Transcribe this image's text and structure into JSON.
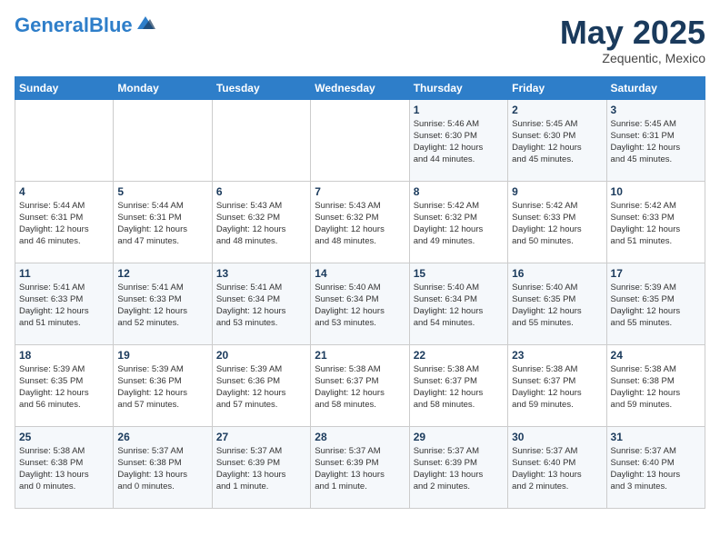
{
  "logo": {
    "general": "General",
    "blue": "Blue",
    "tagline": ""
  },
  "title": "May 2025",
  "subtitle": "Zequentic, Mexico",
  "days_of_week": [
    "Sunday",
    "Monday",
    "Tuesday",
    "Wednesday",
    "Thursday",
    "Friday",
    "Saturday"
  ],
  "weeks": [
    [
      {
        "day": "",
        "info": ""
      },
      {
        "day": "",
        "info": ""
      },
      {
        "day": "",
        "info": ""
      },
      {
        "day": "",
        "info": ""
      },
      {
        "day": "1",
        "info": "Sunrise: 5:46 AM\nSunset: 6:30 PM\nDaylight: 12 hours\nand 44 minutes."
      },
      {
        "day": "2",
        "info": "Sunrise: 5:45 AM\nSunset: 6:30 PM\nDaylight: 12 hours\nand 45 minutes."
      },
      {
        "day": "3",
        "info": "Sunrise: 5:45 AM\nSunset: 6:31 PM\nDaylight: 12 hours\nand 45 minutes."
      }
    ],
    [
      {
        "day": "4",
        "info": "Sunrise: 5:44 AM\nSunset: 6:31 PM\nDaylight: 12 hours\nand 46 minutes."
      },
      {
        "day": "5",
        "info": "Sunrise: 5:44 AM\nSunset: 6:31 PM\nDaylight: 12 hours\nand 47 minutes."
      },
      {
        "day": "6",
        "info": "Sunrise: 5:43 AM\nSunset: 6:32 PM\nDaylight: 12 hours\nand 48 minutes."
      },
      {
        "day": "7",
        "info": "Sunrise: 5:43 AM\nSunset: 6:32 PM\nDaylight: 12 hours\nand 48 minutes."
      },
      {
        "day": "8",
        "info": "Sunrise: 5:42 AM\nSunset: 6:32 PM\nDaylight: 12 hours\nand 49 minutes."
      },
      {
        "day": "9",
        "info": "Sunrise: 5:42 AM\nSunset: 6:33 PM\nDaylight: 12 hours\nand 50 minutes."
      },
      {
        "day": "10",
        "info": "Sunrise: 5:42 AM\nSunset: 6:33 PM\nDaylight: 12 hours\nand 51 minutes."
      }
    ],
    [
      {
        "day": "11",
        "info": "Sunrise: 5:41 AM\nSunset: 6:33 PM\nDaylight: 12 hours\nand 51 minutes."
      },
      {
        "day": "12",
        "info": "Sunrise: 5:41 AM\nSunset: 6:33 PM\nDaylight: 12 hours\nand 52 minutes."
      },
      {
        "day": "13",
        "info": "Sunrise: 5:41 AM\nSunset: 6:34 PM\nDaylight: 12 hours\nand 53 minutes."
      },
      {
        "day": "14",
        "info": "Sunrise: 5:40 AM\nSunset: 6:34 PM\nDaylight: 12 hours\nand 53 minutes."
      },
      {
        "day": "15",
        "info": "Sunrise: 5:40 AM\nSunset: 6:34 PM\nDaylight: 12 hours\nand 54 minutes."
      },
      {
        "day": "16",
        "info": "Sunrise: 5:40 AM\nSunset: 6:35 PM\nDaylight: 12 hours\nand 55 minutes."
      },
      {
        "day": "17",
        "info": "Sunrise: 5:39 AM\nSunset: 6:35 PM\nDaylight: 12 hours\nand 55 minutes."
      }
    ],
    [
      {
        "day": "18",
        "info": "Sunrise: 5:39 AM\nSunset: 6:35 PM\nDaylight: 12 hours\nand 56 minutes."
      },
      {
        "day": "19",
        "info": "Sunrise: 5:39 AM\nSunset: 6:36 PM\nDaylight: 12 hours\nand 57 minutes."
      },
      {
        "day": "20",
        "info": "Sunrise: 5:39 AM\nSunset: 6:36 PM\nDaylight: 12 hours\nand 57 minutes."
      },
      {
        "day": "21",
        "info": "Sunrise: 5:38 AM\nSunset: 6:37 PM\nDaylight: 12 hours\nand 58 minutes."
      },
      {
        "day": "22",
        "info": "Sunrise: 5:38 AM\nSunset: 6:37 PM\nDaylight: 12 hours\nand 58 minutes."
      },
      {
        "day": "23",
        "info": "Sunrise: 5:38 AM\nSunset: 6:37 PM\nDaylight: 12 hours\nand 59 minutes."
      },
      {
        "day": "24",
        "info": "Sunrise: 5:38 AM\nSunset: 6:38 PM\nDaylight: 12 hours\nand 59 minutes."
      }
    ],
    [
      {
        "day": "25",
        "info": "Sunrise: 5:38 AM\nSunset: 6:38 PM\nDaylight: 13 hours\nand 0 minutes."
      },
      {
        "day": "26",
        "info": "Sunrise: 5:37 AM\nSunset: 6:38 PM\nDaylight: 13 hours\nand 0 minutes."
      },
      {
        "day": "27",
        "info": "Sunrise: 5:37 AM\nSunset: 6:39 PM\nDaylight: 13 hours\nand 1 minute."
      },
      {
        "day": "28",
        "info": "Sunrise: 5:37 AM\nSunset: 6:39 PM\nDaylight: 13 hours\nand 1 minute."
      },
      {
        "day": "29",
        "info": "Sunrise: 5:37 AM\nSunset: 6:39 PM\nDaylight: 13 hours\nand 2 minutes."
      },
      {
        "day": "30",
        "info": "Sunrise: 5:37 AM\nSunset: 6:40 PM\nDaylight: 13 hours\nand 2 minutes."
      },
      {
        "day": "31",
        "info": "Sunrise: 5:37 AM\nSunset: 6:40 PM\nDaylight: 13 hours\nand 3 minutes."
      }
    ]
  ]
}
